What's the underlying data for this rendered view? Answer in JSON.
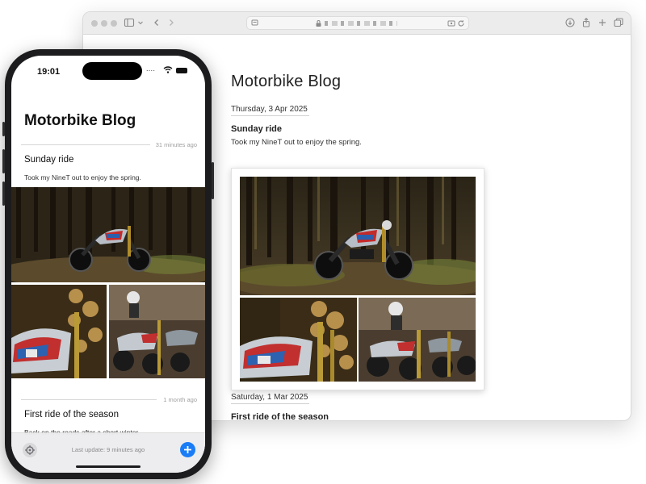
{
  "blog": {
    "title": "Motorbike Blog",
    "posts": [
      {
        "date": "Thursday, 3 Apr 2025",
        "title": "Sunday ride",
        "body": "Took my NineT out to enjoy the spring.",
        "time_ago": "31 minutes ago"
      },
      {
        "date": "Saturday, 1 Mar 2025",
        "title": "First ride of the season",
        "body": "Back on the roads after a short winter.",
        "time_ago": "1 month ago"
      }
    ]
  },
  "phone": {
    "time": "19:01",
    "status": "....",
    "last_update": "Last update: 9 minutes ago"
  },
  "icons": {
    "settings": "gear-icon",
    "add": "plus-icon",
    "back": "chevron-left-icon",
    "forward": "chevron-right-icon",
    "sidebar": "sidebar-icon",
    "share": "share-icon",
    "new_tab": "plus-icon",
    "tabs": "tabs-icon",
    "download": "download-icon",
    "reload": "reload-icon"
  },
  "colors": {
    "accent": "#1a7cf6",
    "phone_frame": "#1c1c1e",
    "toolbar": "#ececec"
  }
}
